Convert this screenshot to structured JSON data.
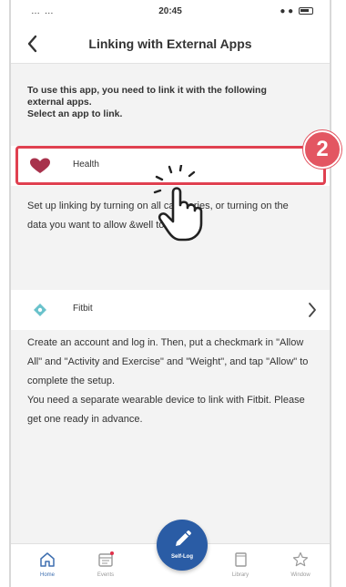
{
  "status_bar": {
    "left": "… …",
    "time": "20:45",
    "right": "● ●"
  },
  "header": {
    "title": "Linking with External Apps",
    "back_icon": "chevron-left-icon"
  },
  "intro_text": "To use this app, you need to link it with the following external apps.\nSelect an app to link.",
  "apps": [
    {
      "name": "Health",
      "icon": "heart-icon",
      "icon_color": "#a8324c",
      "description": "Set up linking by turning on all categories, or turning on the data you want to allow &well to read."
    },
    {
      "name": "Fitbit",
      "icon": "fitbit-icon",
      "icon_color": "#4fb7c2",
      "description": "Create an account and log in. Then, put a checkmark in \"Allow All\" and \"Activity and Exercise\" and \"Weight\", and tap \"Allow\" to complete the setup.\nYou need a separate wearable device to link with Fitbit. Please get one ready in advance."
    }
  ],
  "step_badge": "2",
  "highlight_color": "#e04050",
  "tabs": [
    {
      "label": "Home",
      "icon": "home-icon",
      "active": true
    },
    {
      "label": "Events",
      "icon": "calendar-icon",
      "active": false
    },
    {
      "label": "Self-Log",
      "icon": "pencil-icon",
      "active": false
    },
    {
      "label": "Library",
      "icon": "book-icon",
      "active": false
    },
    {
      "label": "Window",
      "icon": "star-icon",
      "active": false
    }
  ],
  "accent_color": "#2a5ca5"
}
